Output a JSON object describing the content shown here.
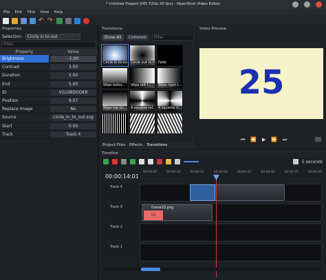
{
  "window": {
    "title": "* Untitled Project [HD 720p 30 fps] - OpenShot Video Editor"
  },
  "menu": [
    "File",
    "Edit",
    "Title",
    "View",
    "Help"
  ],
  "properties": {
    "header": "Properties",
    "selection_label": "Selection:",
    "selection_value": "Circle in to out",
    "filter_placeholder": "Filter",
    "columns": [
      "Property",
      "Value"
    ],
    "rows": [
      {
        "key": "Brightness",
        "value": "-1.00"
      },
      {
        "key": "Contrast",
        "value": "3.00"
      },
      {
        "key": "Duration",
        "value": "5.00"
      },
      {
        "key": "End",
        "value": "5.00"
      },
      {
        "key": "ID",
        "value": "V2LOBDOOKR"
      },
      {
        "key": "Position",
        "value": "9.07"
      },
      {
        "key": "Replace Image",
        "value": "No"
      },
      {
        "key": "Source",
        "value": "circle_in_to_out.svg"
      },
      {
        "key": "Start",
        "value": "0.00"
      },
      {
        "key": "Track",
        "value": "Track 4"
      }
    ]
  },
  "transitions": {
    "header": "Transitions",
    "tabs": [
      "Show All",
      "Common"
    ],
    "filter_placeholder": "Filter",
    "items": [
      {
        "label": "Circle in to out"
      },
      {
        "label": "Circle out to in"
      },
      {
        "label": "Fade"
      },
      {
        "label": "Wipe botto..."
      },
      {
        "label": "Wipe left t..."
      },
      {
        "label": "Wipe right t..."
      },
      {
        "label": "Wipe top to..."
      },
      {
        "label": "4 squares lef..."
      },
      {
        "label": "4 squares ri..."
      },
      {
        "label": ""
      },
      {
        "label": ""
      },
      {
        "label": ""
      }
    ]
  },
  "bottom_tabs": [
    "Project Files",
    "Effects",
    "Transitions"
  ],
  "preview": {
    "header": "Video Preview",
    "frame_number": "25"
  },
  "timeline": {
    "header": "Timeline",
    "zoom_label": "5 seconds",
    "current_time": "00:00:14:01",
    "ruler_ticks": [
      "00:00:05",
      "00:00:10",
      "00:00:15",
      "00:00:20",
      "00:00:25",
      "00:00:30",
      "00:00:35",
      "00:00:40"
    ],
    "tracks": [
      {
        "name": "Track 4"
      },
      {
        "name": "Track 3",
        "clip_label": "frame15.png",
        "clip_thumb": "15"
      },
      {
        "name": "Track 2"
      },
      {
        "name": "Track 1"
      }
    ]
  }
}
